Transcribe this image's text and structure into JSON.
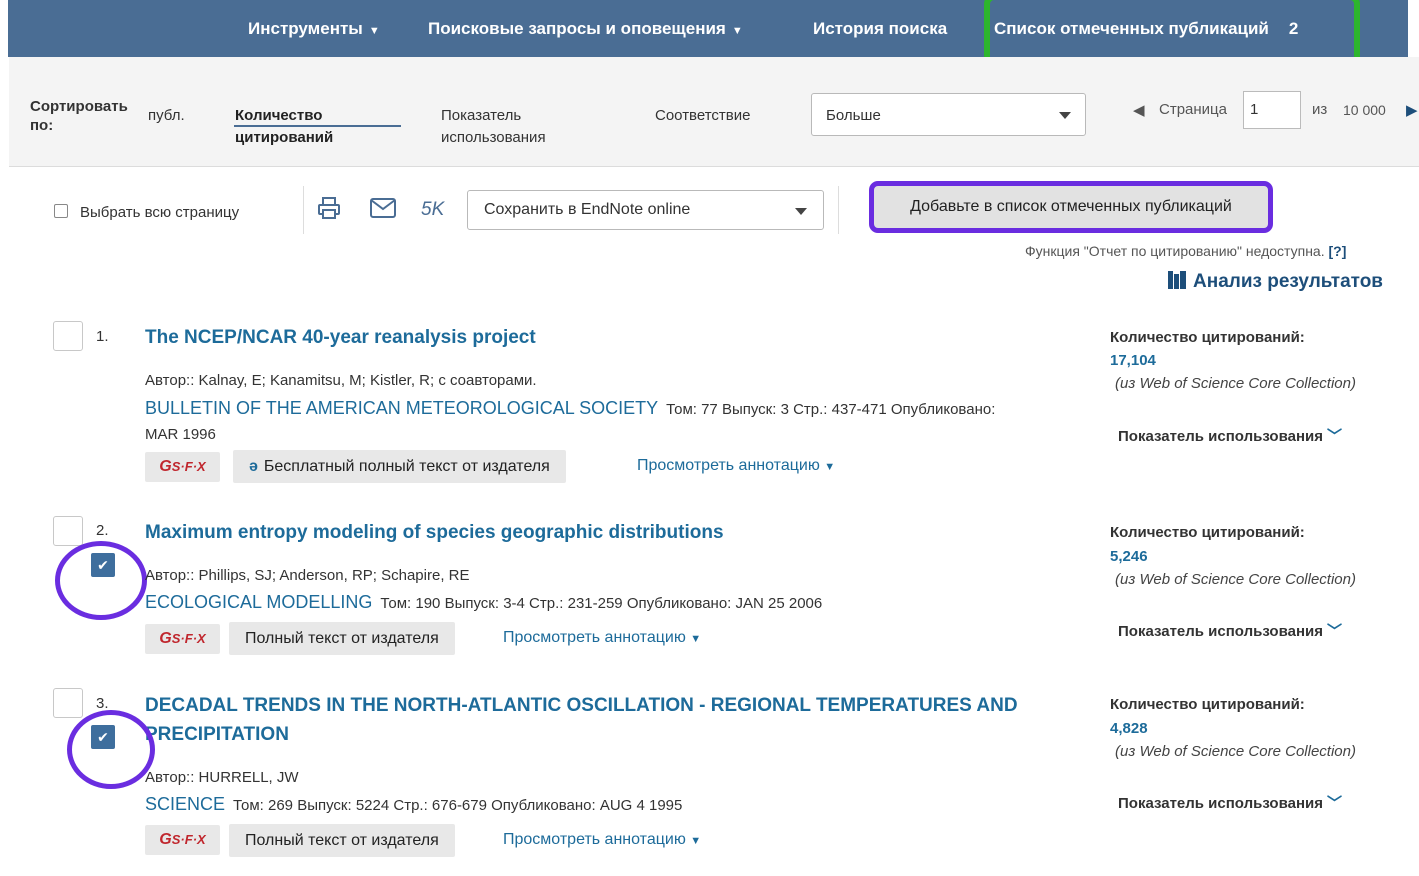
{
  "nav": {
    "tools": "Инструменты",
    "searches_alerts": "Поисковые запросы и оповещения",
    "history": "История поиска",
    "marked_list": "Список отмеченных публикаций",
    "marked_count": "2"
  },
  "sort": {
    "label": "Сортировать по:",
    "options": [
      "публ.",
      "Количество цитирований",
      "Показатель использования",
      "Соответствие"
    ],
    "active_index": 1,
    "more_select": "Больше",
    "page_label": "Страница",
    "page_value": "1",
    "of_label": "из",
    "total_pages": "10 000"
  },
  "toolbar": {
    "select_page": "Выбрать всю страницу",
    "print_icon": "printer-icon",
    "email_icon": "envelope-icon",
    "five_k": "5K",
    "save_select": "Сохранить в EndNote online",
    "add_marked": "Добавьте в список отмеченных публикаций",
    "citation_report": "Функция \"Отчет по цитированию\" недоступна.",
    "citation_help": "[?]",
    "analyze": "Анализ результатов"
  },
  "records": [
    {
      "num": "1.",
      "title": "The NCEP/NCAR 40-year reanalysis project",
      "authors": "Автор:: Kalnay, E; Kanamitsu, M; Kistler, R; с соавторами.",
      "journal": "BULLETIN OF THE AMERICAN METEOROLOGICAL SOCIETY",
      "meta": "Том: 77   Выпуск: 3   Стр.: 437-471   Опубликовано:",
      "date": "MAR 1996",
      "fulltext": "Бесплатный полный текст от издателя",
      "abstract": "Просмотреть аннотацию",
      "cite_label": "Количество цитирований:",
      "cite_count": "17,104",
      "cite_source": "(из Web of Science Core Collection)",
      "usage": "Показатель использования",
      "checked": false
    },
    {
      "num": "2.",
      "title": "Maximum entropy modeling of species geographic distributions",
      "authors": "Автор:: Phillips, SJ; Anderson, RP; Schapire, RE",
      "journal": "ECOLOGICAL MODELLING",
      "meta": "Том: 190   Выпуск: 3-4   Стр.: 231-259   Опубликовано: JAN 25 2006",
      "fulltext": "Полный текст от издателя",
      "abstract": "Просмотреть аннотацию",
      "cite_label": "Количество цитирований:",
      "cite_count": "5,246",
      "cite_source": "(из Web of Science Core Collection)",
      "usage": "Показатель использования",
      "checked": true
    },
    {
      "num": "3.",
      "title_line1": "DECADAL TRENDS IN THE NORTH-ATLANTIC OSCILLATION - REGIONAL TEMPERATURES AND",
      "title_line2": "PRECIPITATION",
      "authors": "Автор:: HURRELL, JW",
      "journal": "SCIENCE",
      "meta": "Том: 269   Выпуск: 5224   Стр.: 676-679   Опубликовано: AUG 4 1995",
      "fulltext": "Полный текст от издателя",
      "abstract": "Просмотреть аннотацию",
      "cite_label": "Количество цитирований:",
      "cite_count": "4,828",
      "cite_source": "(из Web of Science Core Collection)",
      "usage": "Показатель использования",
      "checked": true
    }
  ],
  "sfx_label": "S·F·X",
  "colors": {
    "nav_bg": "#4a6d94",
    "link": "#1d6b9a",
    "highlight_green": "#2db52d",
    "highlight_purple": "#6a2de0"
  }
}
